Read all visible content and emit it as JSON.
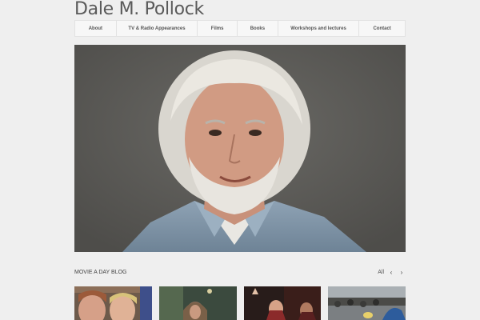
{
  "site": {
    "title": "Dale M. Pollock"
  },
  "nav": {
    "items": [
      {
        "label": "About"
      },
      {
        "label": "TV & Radio Appearances"
      },
      {
        "label": "Films"
      },
      {
        "label": "Books"
      },
      {
        "label": "Workshops and lectures"
      },
      {
        "label": "Contact"
      }
    ]
  },
  "hero": {
    "image_icon": "portrait-photo"
  },
  "blog": {
    "title": "MOVIE A DAY BLOG",
    "all_label": "All",
    "prev_icon": "chevron-left-icon",
    "next_icon": "chevron-right-icon"
  },
  "thumbnails": [
    {
      "icon": "film-still-photo"
    },
    {
      "icon": "film-still-photo"
    },
    {
      "icon": "film-still-photo"
    },
    {
      "icon": "film-still-photo"
    }
  ]
}
